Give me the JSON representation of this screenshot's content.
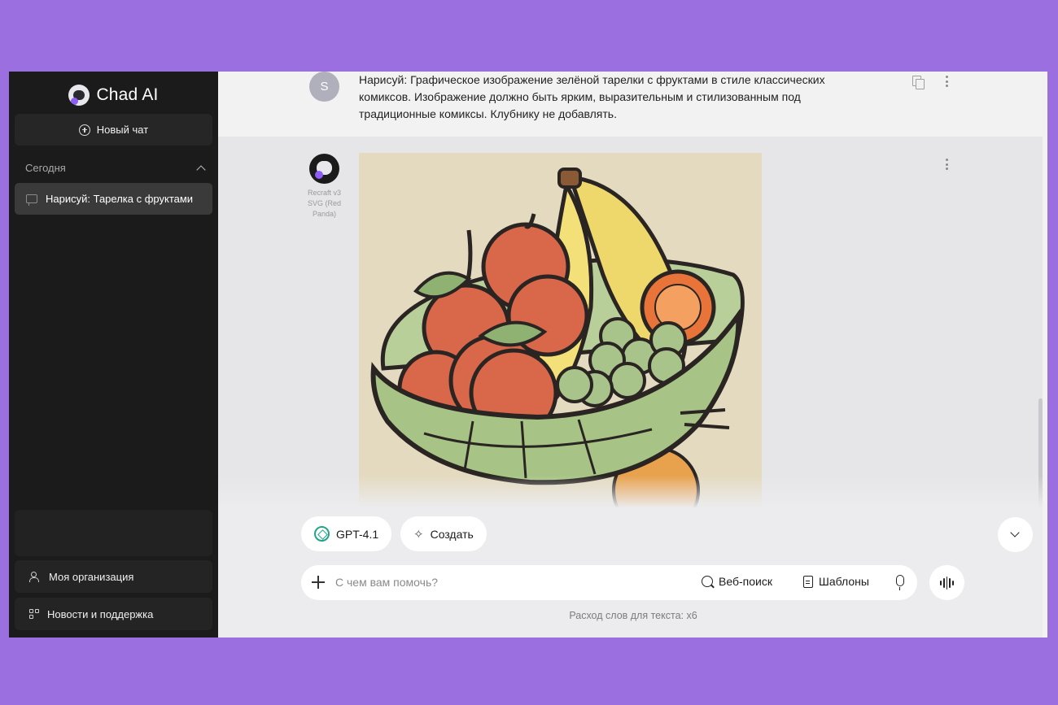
{
  "app": {
    "name": "Chad AI"
  },
  "sidebar": {
    "new_chat_label": "Новый чат",
    "section_title": "Сегодня",
    "chats": [
      {
        "label": "Нарисуй: Тарелка с фруктами"
      }
    ],
    "org_label": "Моя организация",
    "news_label": "Новости и поддержка"
  },
  "conversation": {
    "user": {
      "avatar_letter": "S",
      "text": "Нарисуй: Графическое изображение зелёной тарелки с фруктами в стиле классических комиксов. Изображение должно быть ярким, выразительным и стилизованным под традиционные комиксы. Клубнику не добавлять."
    },
    "assistant": {
      "model_caption": "Recraft v3 SVG (Red Panda)",
      "image_subject": "Comic-style green bowl with apples, banana, grapes and oranges"
    }
  },
  "composer": {
    "model_label": "GPT-4.1",
    "create_label": "Создать",
    "placeholder": "С чем вам помочь?",
    "web_search_label": "Веб-поиск",
    "templates_label": "Шаблоны",
    "usage_note": "Расход слов для текста: x6"
  },
  "colors": {
    "background": "#9b6fe0",
    "sidebar": "#1b1b1b",
    "accent_green": "#1ea686"
  },
  "icons": [
    "logo-icon",
    "plus-circle-icon",
    "chevron-up-icon",
    "chat-bubble-icon",
    "people-icon",
    "grid-plus-icon",
    "copy-icon",
    "more-vertical-icon",
    "plus-icon",
    "search-icon",
    "document-icon",
    "microphone-icon",
    "waveform-icon",
    "chevron-down-icon",
    "sparkle-icon",
    "gpt-icon"
  ]
}
